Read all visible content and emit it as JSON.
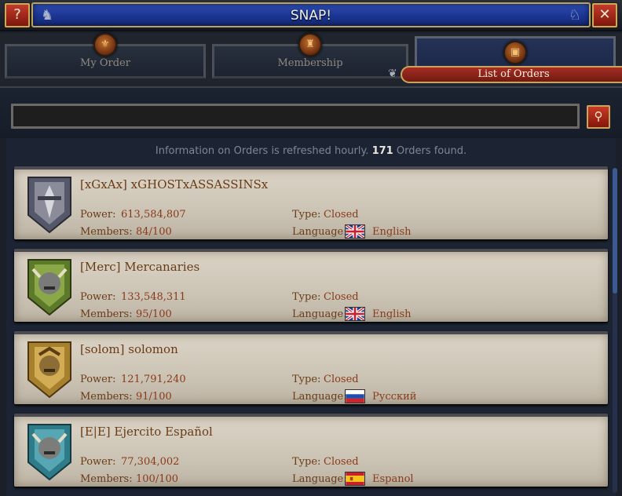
{
  "window": {
    "title": "SNAP!",
    "help_label": "?",
    "close_label": "✕"
  },
  "tabs": [
    {
      "label": "My Order",
      "icon": "order-crest-icon"
    },
    {
      "label": "Membership",
      "icon": "membership-crest-icon"
    },
    {
      "label": "List of Orders",
      "icon": "list-crest-icon",
      "active": true
    }
  ],
  "search": {
    "value": "",
    "button_icon": "search-icon"
  },
  "info": {
    "prefix": "Information on Orders is refreshed hourly.",
    "count": "171",
    "suffix": "Orders found."
  },
  "labels": {
    "power": "Power:",
    "members": "Members:",
    "type": "Type:",
    "language": "Language:"
  },
  "orders": [
    {
      "name": "[xGxAx] xGHOSTxASSASSINSx",
      "power": "613,584,807",
      "members": "84/100",
      "type": "Closed",
      "language": "English",
      "flag": "uk-flag-icon",
      "crest_color": "#5a5a6a",
      "crest": "steel-crest-icon"
    },
    {
      "name": "[Merc] Mercanaries",
      "power": "133,548,311",
      "members": "95/100",
      "type": "Closed",
      "language": "English",
      "flag": "uk-flag-icon",
      "crest_color": "#5d7a2a",
      "crest": "green-crest-icon"
    },
    {
      "name": "[solom] solomon",
      "power": "121,791,240",
      "members": "91/100",
      "type": "Closed",
      "language": "Русский",
      "flag": "russia-flag-icon",
      "crest_color": "#a7802e",
      "crest": "gold-crest-icon"
    },
    {
      "name": "[E|E] Ejercito Español",
      "power": "77,304,002",
      "members": "100/100",
      "type": "Closed",
      "language": "Espanol",
      "flag": "spain-flag-icon",
      "crest_color": "#2e7b8a",
      "crest": "teal-crest-icon"
    }
  ]
}
